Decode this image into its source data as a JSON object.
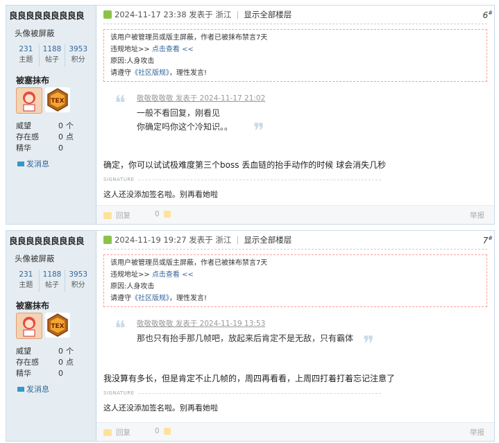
{
  "posts": [
    {
      "author": {
        "name": "良良良良良良良良良",
        "avatar_note": "头像被屏蔽",
        "stats": [
          {
            "num": "231",
            "label": "主题"
          },
          {
            "num": "1188",
            "label": "帖子"
          },
          {
            "num": "3953",
            "label": "积分"
          }
        ],
        "group": "被塞抹布",
        "details": [
          {
            "k": "威望",
            "v": "0",
            "u": "个"
          },
          {
            "k": "存在感",
            "v": "0",
            "u": "点"
          },
          {
            "k": "精华",
            "v": "0",
            "u": ""
          }
        ],
        "pm": "发消息"
      },
      "meta": {
        "time": "2024-11-17 23:38",
        "posted": "发表于",
        "location": "浙江",
        "showall": "显示全部楼层"
      },
      "floor": {
        "num": "6",
        "sup": "#"
      },
      "notice": {
        "l1": "该用户被管理员或版主屏蔽，作者已被抹布禁言7天",
        "l2a": "违规地址>> ",
        "l2b": "点击查看 <<",
        "l3": "原因:人身攻击",
        "l4a": "请遵守",
        "l4b": "《社区版规》",
        "l4c": "，理性发言!"
      },
      "quote": {
        "head": "敬敬敬敬敬 发表于 2024-11-17 21:02",
        "lines": [
          "一般不看回复，刚看见",
          "你确定吗你这个冷知识。。"
        ]
      },
      "content": "确定，你可以试试极难度第三个boss 丢血链的抬手动作的时候 球会消失几秒",
      "sig_label": "SIGNATURE",
      "signature": "这人还没添加签名啦。别再看她啦",
      "footer": {
        "reply": "回复",
        "likes": "0",
        "report": "举报"
      }
    },
    {
      "author": {
        "name": "良良良良良良良良良",
        "avatar_note": "头像被屏蔽",
        "stats": [
          {
            "num": "231",
            "label": "主题"
          },
          {
            "num": "1188",
            "label": "帖子"
          },
          {
            "num": "3953",
            "label": "积分"
          }
        ],
        "group": "被塞抹布",
        "details": [
          {
            "k": "威望",
            "v": "0",
            "u": "个"
          },
          {
            "k": "存在感",
            "v": "0",
            "u": "点"
          },
          {
            "k": "精华",
            "v": "0",
            "u": ""
          }
        ],
        "pm": "发消息"
      },
      "meta": {
        "time": "2024-11-19 19:27",
        "posted": "发表于",
        "location": "浙江",
        "showall": "显示全部楼层"
      },
      "floor": {
        "num": "7",
        "sup": "#"
      },
      "notice": {
        "l1": "该用户被管理员或版主屏蔽，作者已被抹布禁言7天",
        "l2a": "违规地址>> ",
        "l2b": "点击查看 <<",
        "l3": "原因:人身攻击",
        "l4a": "请遵守",
        "l4b": "《社区版规》",
        "l4c": "，理性发言!"
      },
      "quote": {
        "head": "敬敬敬敬敬 发表于 2024-11-19 13:53",
        "lines": [
          "那也只有抬手那几帧吧，放起来后肯定不是无敌，只有霸体"
        ]
      },
      "content": "我没算有多长，但是肯定不止几帧的，周四再看看，上周四打着打着忘记注意了",
      "sig_label": "SIGNATURE",
      "signature": "这人还没添加签名啦。别再看她啦",
      "footer": {
        "reply": "回复",
        "likes": "0",
        "report": "举报"
      }
    }
  ],
  "colors": {
    "border": "#cbdaea",
    "sidebar": "#e5edf2",
    "link": "#336699",
    "notice_border": "#ff9a9a"
  }
}
